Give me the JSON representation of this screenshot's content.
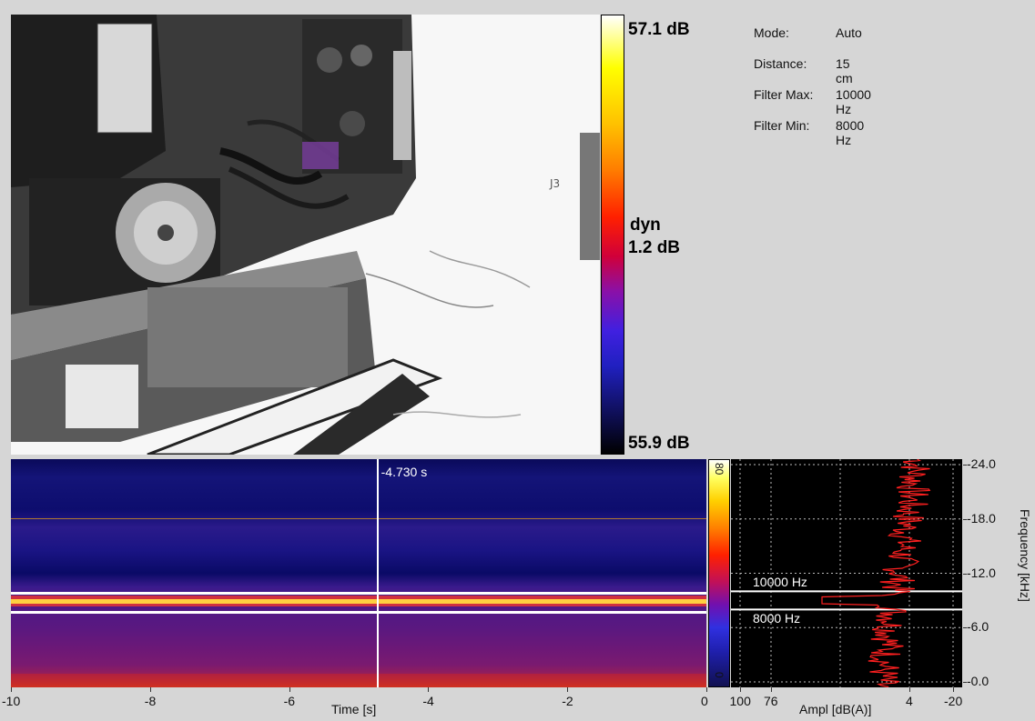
{
  "colors": {
    "background": "#d6d6d6",
    "marker": "#ffffff",
    "amplitude_trace": "#ff2020",
    "spectrogram_ceiling": "#ffd040"
  },
  "scale": {
    "max": "57.1 dB",
    "mode_label": "dyn",
    "range": "1.2 dB",
    "min": "55.9 dB"
  },
  "info": [
    {
      "key": "Mode:",
      "value": "Auto"
    },
    {
      "key": "Distance:",
      "value": "15 cm"
    },
    {
      "key": "Filter Max:",
      "value": "10000 Hz"
    },
    {
      "key": "Filter Min:",
      "value": "8000 Hz"
    }
  ],
  "spectrogram": {
    "cursor_time_label": "-4.730 s",
    "cursor_time": -4.73,
    "colorbar_top": "80",
    "colorbar_bottom": "0"
  },
  "time_axis": {
    "title": "Time [s]",
    "range": [
      -10,
      0
    ],
    "ticks": [
      "-10",
      "-8",
      "-6",
      "-4",
      "-2",
      "0"
    ]
  },
  "amplitude_axis": {
    "title": "Ampl [dB(A)]",
    "ticks": [
      "100",
      "76",
      "4",
      "-20"
    ]
  },
  "frequency_axis": {
    "title": "Frequency [kHz]",
    "range": [
      0,
      24
    ],
    "ticks": [
      "-24.0",
      "-18.0",
      "-12.0",
      "-6.0",
      "-0.0"
    ]
  },
  "filter": {
    "max_label": "10000 Hz",
    "max_khz": 10,
    "min_label": "8000 Hz",
    "min_khz": 8
  }
}
